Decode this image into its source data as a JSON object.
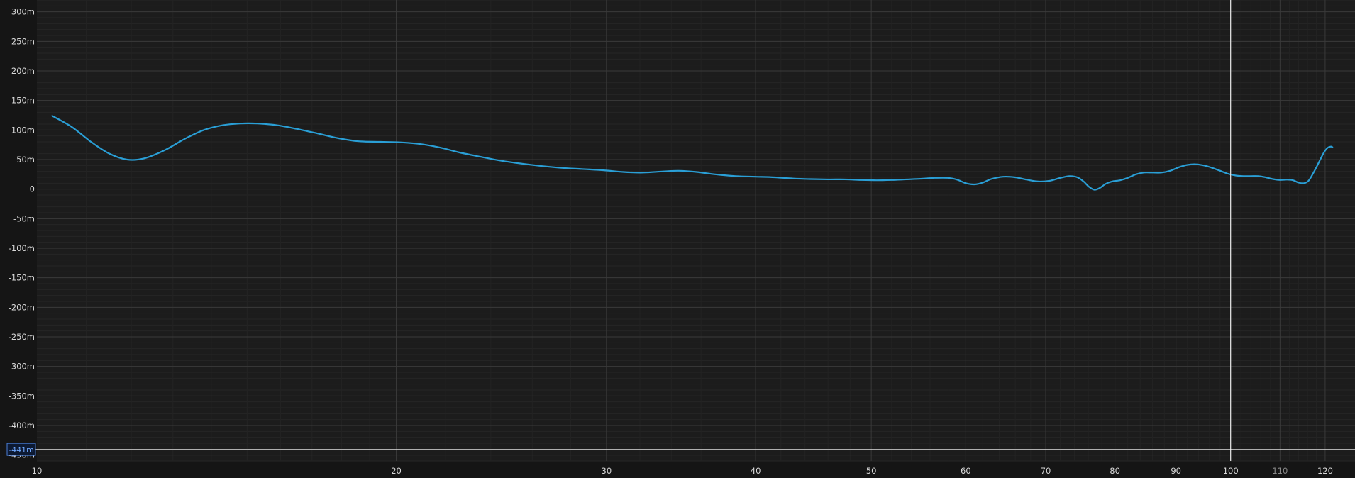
{
  "chart_data": {
    "type": "line",
    "title": "",
    "xlabel": "",
    "ylabel": "",
    "x_scale": "log",
    "xlim": [
      10,
      122
    ],
    "ylim": [
      -460,
      320
    ],
    "grid": true,
    "y_ticks": [
      {
        "value": 300,
        "label": "300m"
      },
      {
        "value": 250,
        "label": "250m"
      },
      {
        "value": 200,
        "label": "200m"
      },
      {
        "value": 150,
        "label": "150m"
      },
      {
        "value": 100,
        "label": "100m"
      },
      {
        "value": 50,
        "label": "50m"
      },
      {
        "value": 0,
        "label": "0"
      },
      {
        "value": -50,
        "label": "-50m"
      },
      {
        "value": -100,
        "label": "-100m"
      },
      {
        "value": -150,
        "label": "-150m"
      },
      {
        "value": -200,
        "label": "-200m"
      },
      {
        "value": -250,
        "label": "-250m"
      },
      {
        "value": -300,
        "label": "-300m"
      },
      {
        "value": -350,
        "label": "-350m"
      },
      {
        "value": -400,
        "label": "-400m"
      },
      {
        "value": -450,
        "label": "-450m"
      }
    ],
    "x_ticks": [
      {
        "value": 10,
        "label": "10"
      },
      {
        "value": 20,
        "label": "20"
      },
      {
        "value": 30,
        "label": "30"
      },
      {
        "value": 40,
        "label": "40"
      },
      {
        "value": 50,
        "label": "50"
      },
      {
        "value": 60,
        "label": "60"
      },
      {
        "value": 70,
        "label": "70"
      },
      {
        "value": 80,
        "label": "80"
      },
      {
        "value": 90,
        "label": "90"
      },
      {
        "value": 100,
        "label": "100"
      },
      {
        "value": 110,
        "label": "110",
        "dim": true
      },
      {
        "value": 120,
        "label": "120"
      }
    ],
    "series": [
      {
        "color": "#2a9fd6",
        "points": [
          [
            10.3,
            124
          ],
          [
            10.7,
            105
          ],
          [
            11.1,
            80
          ],
          [
            11.5,
            60
          ],
          [
            11.9,
            50
          ],
          [
            12.3,
            52
          ],
          [
            12.8,
            66
          ],
          [
            13.3,
            85
          ],
          [
            13.8,
            100
          ],
          [
            14.3,
            108
          ],
          [
            14.8,
            111
          ],
          [
            15.3,
            111
          ],
          [
            15.9,
            108
          ],
          [
            16.5,
            102
          ],
          [
            17.2,
            94
          ],
          [
            17.9,
            86
          ],
          [
            18.6,
            81
          ],
          [
            19.4,
            80
          ],
          [
            20.2,
            79
          ],
          [
            21.0,
            76
          ],
          [
            21.8,
            70
          ],
          [
            22.6,
            62
          ],
          [
            23.5,
            55
          ],
          [
            24.5,
            48
          ],
          [
            25.5,
            43
          ],
          [
            26.5,
            39
          ],
          [
            27.5,
            36
          ],
          [
            28.6,
            34
          ],
          [
            29.8,
            32
          ],
          [
            31.0,
            29
          ],
          [
            32.2,
            28
          ],
          [
            33.5,
            30
          ],
          [
            34.5,
            31
          ],
          [
            35.7,
            29
          ],
          [
            37.0,
            25
          ],
          [
            38.5,
            22
          ],
          [
            40.0,
            21
          ],
          [
            41.5,
            20
          ],
          [
            43.0,
            18
          ],
          [
            44.5,
            17
          ],
          [
            46.0,
            16.5
          ],
          [
            47.5,
            16.5
          ],
          [
            49.0,
            15.5
          ],
          [
            50.5,
            15
          ],
          [
            52.0,
            15.5
          ],
          [
            53.5,
            16.5
          ],
          [
            55.0,
            17.5
          ],
          [
            56.5,
            19
          ],
          [
            58.0,
            19
          ],
          [
            59.0,
            16
          ],
          [
            60.0,
            10
          ],
          [
            61.0,
            8
          ],
          [
            62.0,
            11
          ],
          [
            63.0,
            17
          ],
          [
            64.5,
            21
          ],
          [
            66.0,
            20
          ],
          [
            67.5,
            16
          ],
          [
            69.0,
            13
          ],
          [
            70.5,
            14
          ],
          [
            72.0,
            19
          ],
          [
            73.3,
            22
          ],
          [
            74.4,
            20
          ],
          [
            75.3,
            13
          ],
          [
            76.1,
            4
          ],
          [
            76.9,
            -1
          ],
          [
            77.7,
            2
          ],
          [
            78.6,
            9
          ],
          [
            79.6,
            13
          ],
          [
            80.8,
            15
          ],
          [
            82.0,
            19
          ],
          [
            83.3,
            25
          ],
          [
            84.6,
            28
          ],
          [
            86.0,
            28
          ],
          [
            87.5,
            28
          ],
          [
            89.0,
            31
          ],
          [
            90.5,
            37
          ],
          [
            92.0,
            41
          ],
          [
            93.5,
            42
          ],
          [
            95.0,
            40
          ],
          [
            96.5,
            36
          ],
          [
            98.0,
            31
          ],
          [
            99.5,
            26
          ],
          [
            101.0,
            23
          ],
          [
            102.5,
            22
          ],
          [
            104.0,
            22
          ],
          [
            105.5,
            22
          ],
          [
            107.0,
            20
          ],
          [
            108.5,
            17
          ],
          [
            110.0,
            15.5
          ],
          [
            111.5,
            16
          ],
          [
            112.8,
            15
          ],
          [
            114.0,
            11
          ],
          [
            115.2,
            10
          ],
          [
            116.2,
            14
          ],
          [
            117.2,
            26
          ],
          [
            118.2,
            40
          ],
          [
            119.0,
            52
          ],
          [
            119.8,
            63
          ],
          [
            120.6,
            70
          ],
          [
            121.3,
            72
          ],
          [
            121.7,
            71
          ]
        ]
      }
    ],
    "cursor": {
      "x": 100,
      "y": -441,
      "label": "-441m"
    }
  }
}
